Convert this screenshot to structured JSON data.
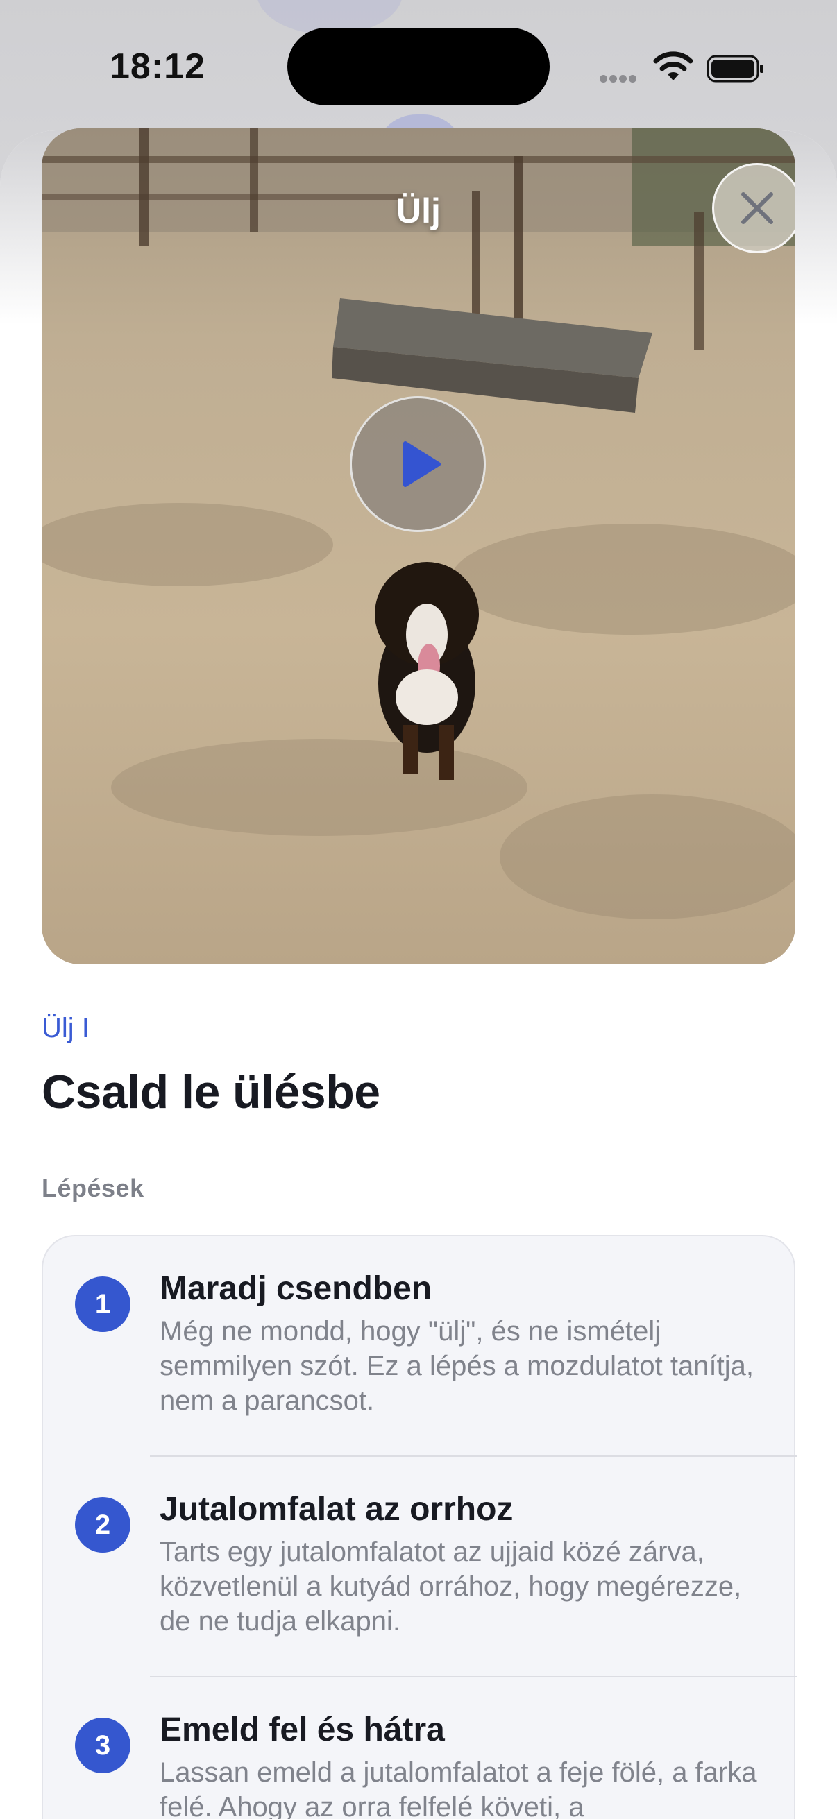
{
  "status_bar": {
    "time": "18:12"
  },
  "video": {
    "title": "Ülj",
    "close_icon": "close-icon",
    "play_icon": "play-icon"
  },
  "content": {
    "subtitle": "Ülj I",
    "title": "Csald le ülésbe",
    "section_label": "Lépések"
  },
  "steps": [
    {
      "number": "1",
      "title": "Maradj csendben",
      "description": "Még ne mondd, hogy \"ülj\", és ne ismételj semmilyen szót. Ez a lépés a mozdulatot tanítja, nem a parancsot."
    },
    {
      "number": "2",
      "title": "Jutalomfalat az orrhoz",
      "description": "Tarts egy jutalomfalatot az ujjaid közé zárva, közvetlenül a kutyád orrához, hogy megérezze, de ne tudja elkapni."
    },
    {
      "number": "3",
      "title": "Emeld fel és hátra",
      "description": "Lassan emeld a jutalomfalatot a feje fölé, a farka felé. Ahogy az orra felfelé követi, a"
    }
  ],
  "colors": {
    "accent": "#3557cf",
    "link": "#3a5bd4",
    "card_bg": "#f4f5f9"
  }
}
